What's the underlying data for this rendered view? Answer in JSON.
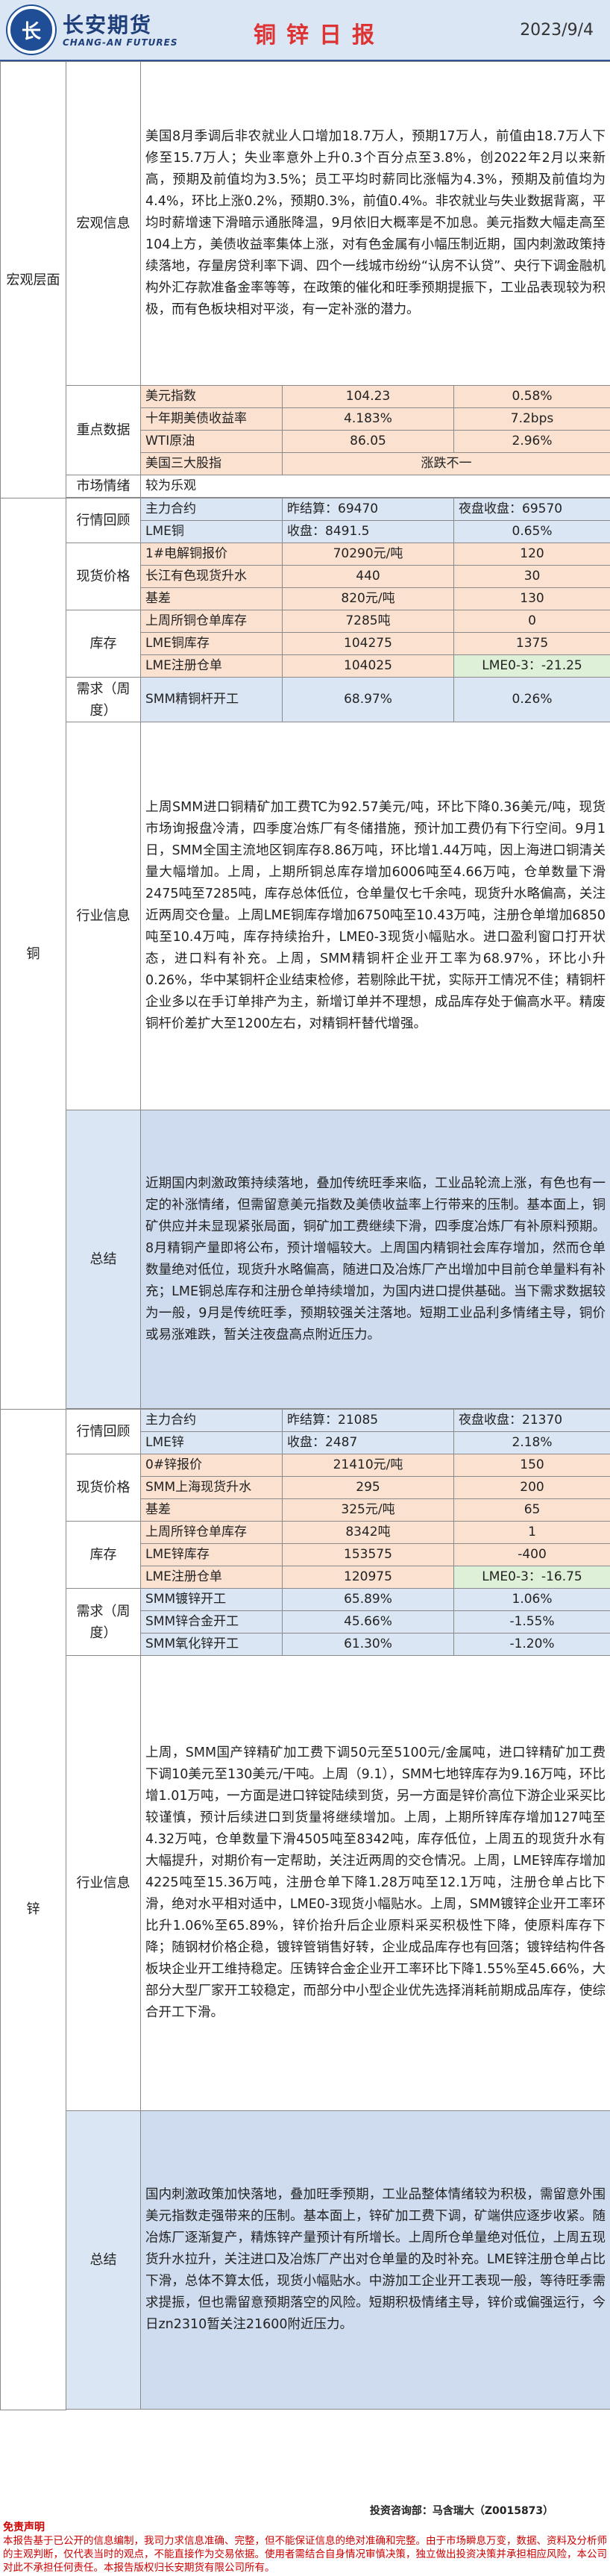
{
  "header": {
    "logo_glyph": "长",
    "brand_cn": "长安期货",
    "brand_en": "CHANG-AN FUTURES",
    "title": "铜锌日报",
    "date": "2023/9/4"
  },
  "macro": {
    "section": "宏观层面",
    "label": "宏观信息",
    "text": "美国8月季调后非农就业人口增加18.7万人，预期17万人，前值由18.7万人下修至15.7万人；失业率意外上升0.3个百分点至3.8%，创2022年2月以来新高，预期及前值均为3.5%；员工平均时薪同比涨幅为4.3%，预期及前值均为4.4%，环比上涨0.2%，预期0.3%，前值0.4%。非农就业与失业数据背离，平均时薪增速下滑暗示通胀降温，9月依旧大概率是不加息。美元指数大幅走高至104上方，美债收益率集体上涨，对有色金属有小幅压制近期，国内刺激政策持续落地，存量房贷利率下调、四个一线城市纷纷“认房不认贷”、央行下调金融机构外汇存款准备金率等等，在政策的催化和旺季预期提振下，工业品表现较为积极，而有色板块相对平淡，有一定补涨的潜力。",
    "indicators_label": "重点数据",
    "indicators": [
      {
        "name": "美元指数",
        "value": "104.23",
        "change": "0.58%"
      },
      {
        "name": "十年期美债收益率",
        "value": "4.183%",
        "change": "7.2bps"
      },
      {
        "name": "WTI原油",
        "value": "86.05",
        "change": "2.96%"
      },
      {
        "name": "美国三大股指",
        "value": "涨跌不一",
        "change": ""
      }
    ],
    "sentiment_label": "市场情绪",
    "sentiment": "较为乐观"
  },
  "copper": {
    "section": "铜",
    "rows": [
      {
        "group": "行情回顾",
        "name": "主力合约",
        "v1": "昨结算：69470",
        "v2": "夜盘收盘：69570"
      },
      {
        "group": "",
        "name": "LME铜",
        "v1": "收盘：8491.5",
        "v2": "0.65%"
      },
      {
        "group": "现货价格",
        "name": "1#电解铜报价",
        "v1": "70290元/吨",
        "v2": "120"
      },
      {
        "group": "",
        "name": "长江有色现货升水",
        "v1": "440",
        "v2": "30"
      },
      {
        "group": "",
        "name": "基差",
        "v1": "820元/吨",
        "v2": "130"
      },
      {
        "group": "库存",
        "name": "上周所铜仓单库存",
        "v1": "7285吨",
        "v2": "0"
      },
      {
        "group": "",
        "name": "LME铜库存",
        "v1": "104275",
        "v2": "1375"
      },
      {
        "group": "",
        "name": "LME注册仓单",
        "v1": "104025",
        "v2": "LME0-3：-21.25"
      },
      {
        "group": "需求（周度）",
        "name": "SMM精铜杆开工",
        "v1": "68.97%",
        "v2": "0.26%"
      }
    ],
    "industry_label": "行业信息",
    "industry": "上周SMM进口铜精矿加工费TC为92.57美元/吨，环比下降0.36美元/吨，现货市场询报盘冷清，四季度冶炼厂有冬储措施，预计加工费仍有下行空间。9月1日，SMM全国主流地区铜库存8.86万吨，环比增1.44万吨，因上海进口铜清关量大幅增加。上周，上期所铜总库存增加6006吨至4.66万吨，仓单数量下滑2475吨至7285吨，库存总体低位，仓单量仅七千余吨，现货升水略偏高，关注近两周交仓量。上周LME铜库存增加6750吨至10.43万吨，注册仓单增加6850吨至10.4万吨，库存持续抬升，LME0-3现货小幅贴水。进口盈利窗口打开状态，进口料有补充。上周，SMM精铜杆企业开工率为68.97%，环比小升0.26%，华中某铜杆企业结束检修，若剔除此干扰，实际开工情况不佳；精铜杆企业多以在手订单排产为主，新增订单并不理想，成品库存处于偏高水平。精废铜杆价差扩大至1200左右，对精铜杆替代增强。",
    "summary_label": "总结",
    "summary": "近期国内刺激政策持续落地，叠加传统旺季来临，工业品轮流上涨，有色也有一定的补涨情绪，但需留意美元指数及美债收益率上行带来的压制。基本面上，铜矿供应并未显现紧张局面，铜矿加工费继续下滑，四季度冶炼厂有补原料预期。8月精铜产量即将公布，预计增幅较大。上周国内精铜社会库存增加，然而仓单数量绝对低位，现货升水略偏高，随进口及冶炼厂产出增加中目前仓单量料有补充；LME铜总库存和注册仓单持续增加，为国内进口提供基础。当下需求数据较为一般，9月是传统旺季，预期较强关注落地。短期工业品利多情绪主导，铜价或易涨难跌，暂关注夜盘高点附近压力。"
  },
  "zinc": {
    "section": "锌",
    "rows": [
      {
        "group": "行情回顾",
        "name": "主力合约",
        "v1": "昨结算：21085",
        "v2": "夜盘收盘：21370"
      },
      {
        "group": "",
        "name": "LME锌",
        "v1": "收盘：2487",
        "v2": "2.18%"
      },
      {
        "group": "现货价格",
        "name": "0#锌报价",
        "v1": "21410元/吨",
        "v2": "150"
      },
      {
        "group": "",
        "name": "SMM上海现货升水",
        "v1": "295",
        "v2": "200"
      },
      {
        "group": "",
        "name": "基差",
        "v1": "325元/吨",
        "v2": "65"
      },
      {
        "group": "库存",
        "name": "上周所锌仓单库存",
        "v1": "8342吨",
        "v2": "1"
      },
      {
        "group": "",
        "name": "LME锌库存",
        "v1": "153575",
        "v2": "-400"
      },
      {
        "group": "",
        "name": "LME注册仓单",
        "v1": "120975",
        "v2": "LME0-3：-16.75"
      },
      {
        "group": "需求（周度）",
        "name": "SMM镀锌开工",
        "v1": "65.89%",
        "v2": "1.06%"
      },
      {
        "group": "",
        "name": "SMM锌合金开工",
        "v1": "45.66%",
        "v2": "-1.55%"
      },
      {
        "group": "",
        "name": "SMM氧化锌开工",
        "v1": "61.30%",
        "v2": "-1.20%"
      }
    ],
    "industry_label": "行业信息",
    "industry": "上周，SMM国产锌精矿加工费下调50元至5100元/金属吨，进口锌精矿加工费下调10美元至130美元/干吨。上周（9.1），SMM七地锌库存为9.16万吨，环比增1.01万吨，一方面是进口锌锭陆续到货，另一方面是锌价高位下游企业采买比较谨慎，预计后续进口到货量将继续增加。上周，上期所锌库存增加127吨至4.32万吨，仓单数量下滑4505吨至8342吨，库存低位，上周五的现货升水有大幅提升，对期价有一定帮助，关注近两周的交仓情况。上周，LME锌库存增加4225吨至15.36万吨，注册仓单下降1.28万吨至12.1万吨，注册仓单占比下滑，绝对水平相对适中，LME0-3现货小幅贴水。上周，SMM镀锌企业开工率环比升1.06%至65.89%，锌价抬升后企业原料采买积极性下降，使原料库存下降；随钢材价格企稳，镀锌管销售好转，企业成品库存也有回落；镀锌结构件各板块企业开工维持稳定。压铸锌合金企业开工率环比下降1.55%至45.66%，大部分大型厂家开工较稳定，而部分中小型企业优先选择消耗前期成品库存，使综合开工下滑。",
    "summary_label": "总结",
    "summary": "国内刺激政策加快落地，叠加旺季预期，工业品整体情绪较为积极，需留意外围美元指数走强带来的压制。基本面上，锌矿加工费下调，矿端供应逐步收紧。随冶炼厂逐渐复产，精炼锌产量预计有所增长。上周所仓单量绝对低位，上周五现货升水拉升，关注进口及冶炼厂产出对仓单量的及时补充。LME锌注册仓单占比下滑，总体不算太低，现货小幅贴水。中游加工企业开工表现一般，等待旺季需求提振，但也需留意预期落空的风险。短期积极情绪主导，锌价或偏强运行，今日zn2310暂关注21600附近压力。"
  },
  "footer": {
    "analyst": "投资咨询部：马含瑞大（Z0015873）",
    "disclaimer_title": "免责声明",
    "disclaimer": "本报告基于已公开的信息编制，我司力求信息准确、完整，但不能保证信息的绝对准确和完整。由于市场瞬息万变，数据、资料及分析师的主观判断，仅代表当时的观点，不能直接作为交易依据。使用者需结合自身情况审慎决策，独立做出投资决策并承担相应风险，本公司对此不承担任何责任。本报告版权归长安期货有限公司所有。"
  }
}
